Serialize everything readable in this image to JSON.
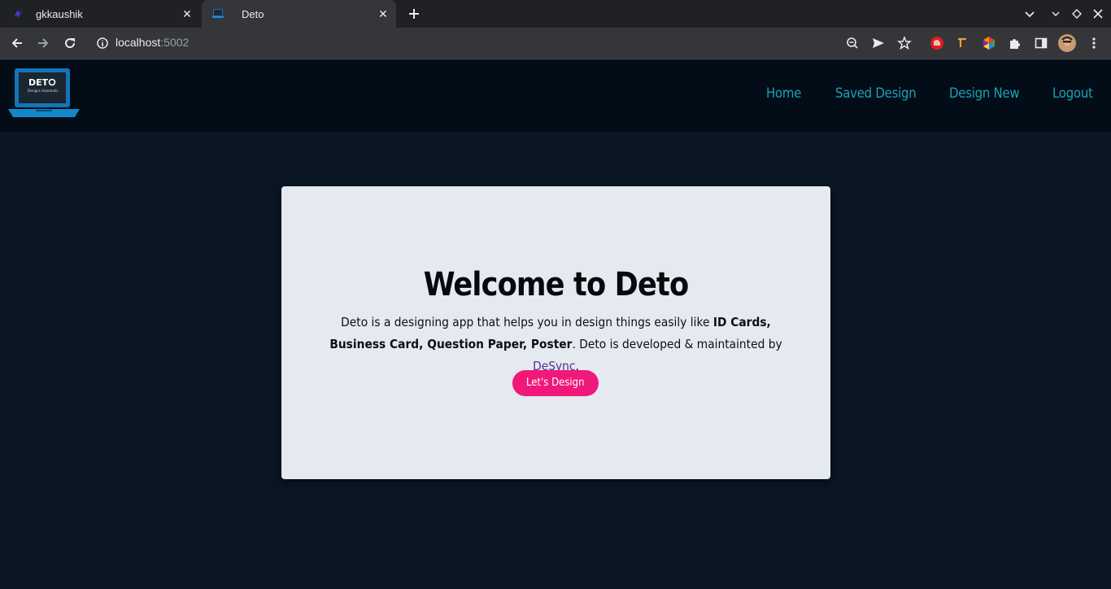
{
  "browser": {
    "tabs": [
      {
        "title": "gkkaushik",
        "active": false
      },
      {
        "title": "Deto",
        "active": true
      }
    ],
    "url_host": "localhost",
    "url_port": ":5002"
  },
  "navbar": {
    "logo_text": "DETO",
    "logo_subtext": "Designs Automatic",
    "links": [
      "Home",
      "Saved Design",
      "Design New",
      "Logout"
    ]
  },
  "hero": {
    "title": "Welcome to Deto",
    "desc_part1": "Deto is a designing app that helps you in design things easily like ",
    "desc_bold": "ID Cards, Business Card, Question Paper, Poster",
    "desc_part2": ". Deto is developed & maintainted by ",
    "desc_brand": "DeSync",
    "desc_end": ".",
    "cta_label": "Let's Design"
  },
  "colors": {
    "page_bg": "#0a1624",
    "navbar_bg": "#020d18",
    "nav_link": "#1aa3b3",
    "card_bg": "#e4eaef",
    "cta_bg": "#f0197a",
    "brand_link": "#5b2c92"
  },
  "icons": [
    "back-icon",
    "forward-icon",
    "reload-icon",
    "info-icon",
    "zoom-icon",
    "send-icon",
    "star-icon",
    "extensions-icon",
    "sidepanel-icon",
    "profile-avatar",
    "menu-icon"
  ]
}
